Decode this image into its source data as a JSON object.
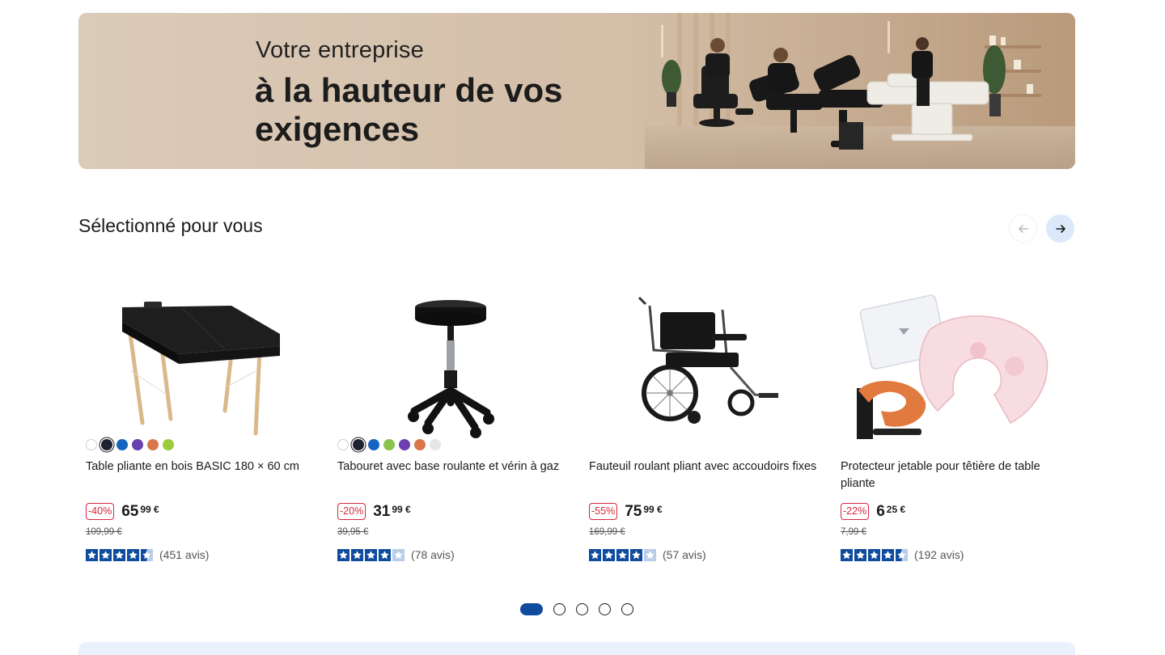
{
  "hero": {
    "kicker": "Votre entreprise",
    "title": "à la hauteur de vos exigences"
  },
  "section": {
    "title": "Sélectionné pour vous",
    "prev_icon": "arrow-left-icon",
    "next_icon": "arrow-right-icon"
  },
  "colors": {
    "accent": "#0f4c9e",
    "discount": "#d6263c",
    "star": "#0f4c9e",
    "next_button_bg": "#dbe9fb"
  },
  "products": [
    {
      "title": "Table pliante en bois BASIC 180 × 60 cm",
      "discount": "-40%",
      "price_int": "65",
      "price_dec": "99 €",
      "old_price": "109,99 €",
      "rating": 4.5,
      "reviews": "(451 avis)",
      "swatches": [
        "#ffffff",
        "#1c2230",
        "#1565c0",
        "#6a3fb0",
        "#d9774a",
        "#9ccc3c"
      ],
      "selected_swatch": 1
    },
    {
      "title": "Tabouret avec base roulante et vérin à gaz",
      "discount": "-20%",
      "price_int": "31",
      "price_dec": "99 €",
      "old_price": "39,95 €",
      "rating": 4,
      "reviews": "(78 avis)",
      "swatches": [
        "#ffffff",
        "#1c2230",
        "#1565c0",
        "#8bc34a",
        "#6a3fb0",
        "#d9774a",
        "#e6e6e6"
      ],
      "selected_swatch": 1
    },
    {
      "title": "Fauteuil roulant pliant avec accoudoirs fixes",
      "discount": "-55%",
      "price_int": "75",
      "price_dec": "99 €",
      "old_price": "169,99 €",
      "rating": 4,
      "reviews": "(57 avis)",
      "swatches": [],
      "selected_swatch": -1
    },
    {
      "title": "Protecteur jetable pour têtière de table pliante",
      "discount": "-22%",
      "price_int": "6",
      "price_dec": "25 €",
      "old_price": "7,99 €",
      "rating": 4.5,
      "reviews": "(192 avis)",
      "swatches": [],
      "selected_swatch": -1
    }
  ],
  "pagination": {
    "pages": 5,
    "current": 1
  }
}
